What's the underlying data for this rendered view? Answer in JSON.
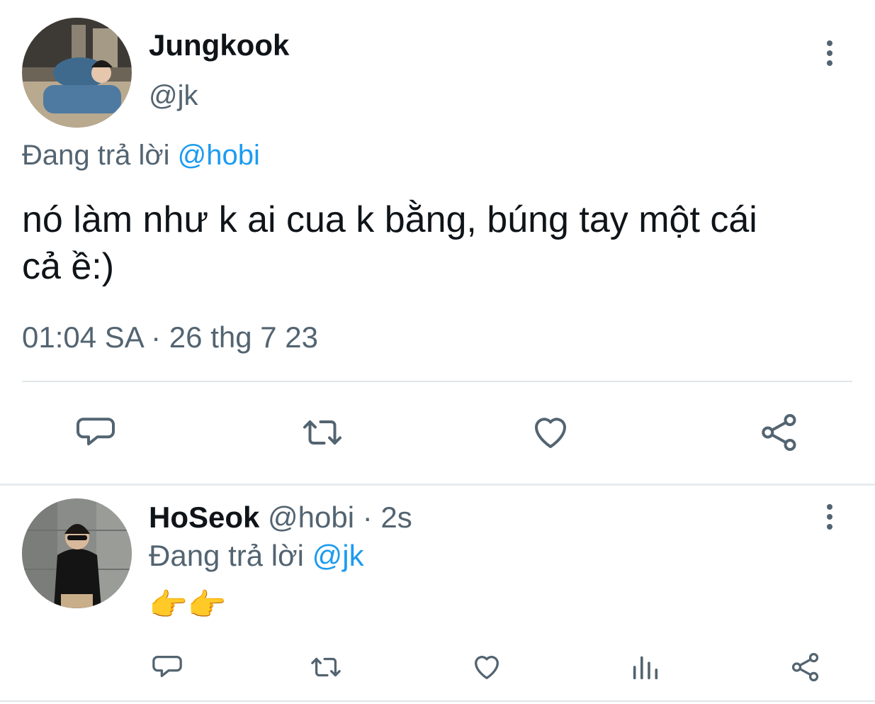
{
  "main_tweet": {
    "author_name": "Jungkook",
    "handle": "@jk",
    "replying_prefix": "Đang trả lời",
    "replying_to": "@hobi",
    "text_line1": "nó làm như k ai cua k bằng, búng tay một cái",
    "text_line2": "cả ề:)",
    "timestamp": "01:04 SA · 26 thg 7 23",
    "actions": [
      "reply-icon",
      "retweet-icon",
      "like-icon",
      "share-icon"
    ]
  },
  "reply": {
    "author_name": "HoSeok",
    "handle": "@hobi",
    "time": "· 2s",
    "replying_prefix": "Đang trả lời",
    "replying_to": "@jk",
    "text": "👉👉",
    "actions": [
      "reply-icon",
      "retweet-icon",
      "like-icon",
      "analytics-icon",
      "share-icon"
    ]
  },
  "colors": {
    "text": "#0f1419",
    "secondary": "#536471",
    "link": "#1d9bf0",
    "divider": "#e1e6ea"
  }
}
